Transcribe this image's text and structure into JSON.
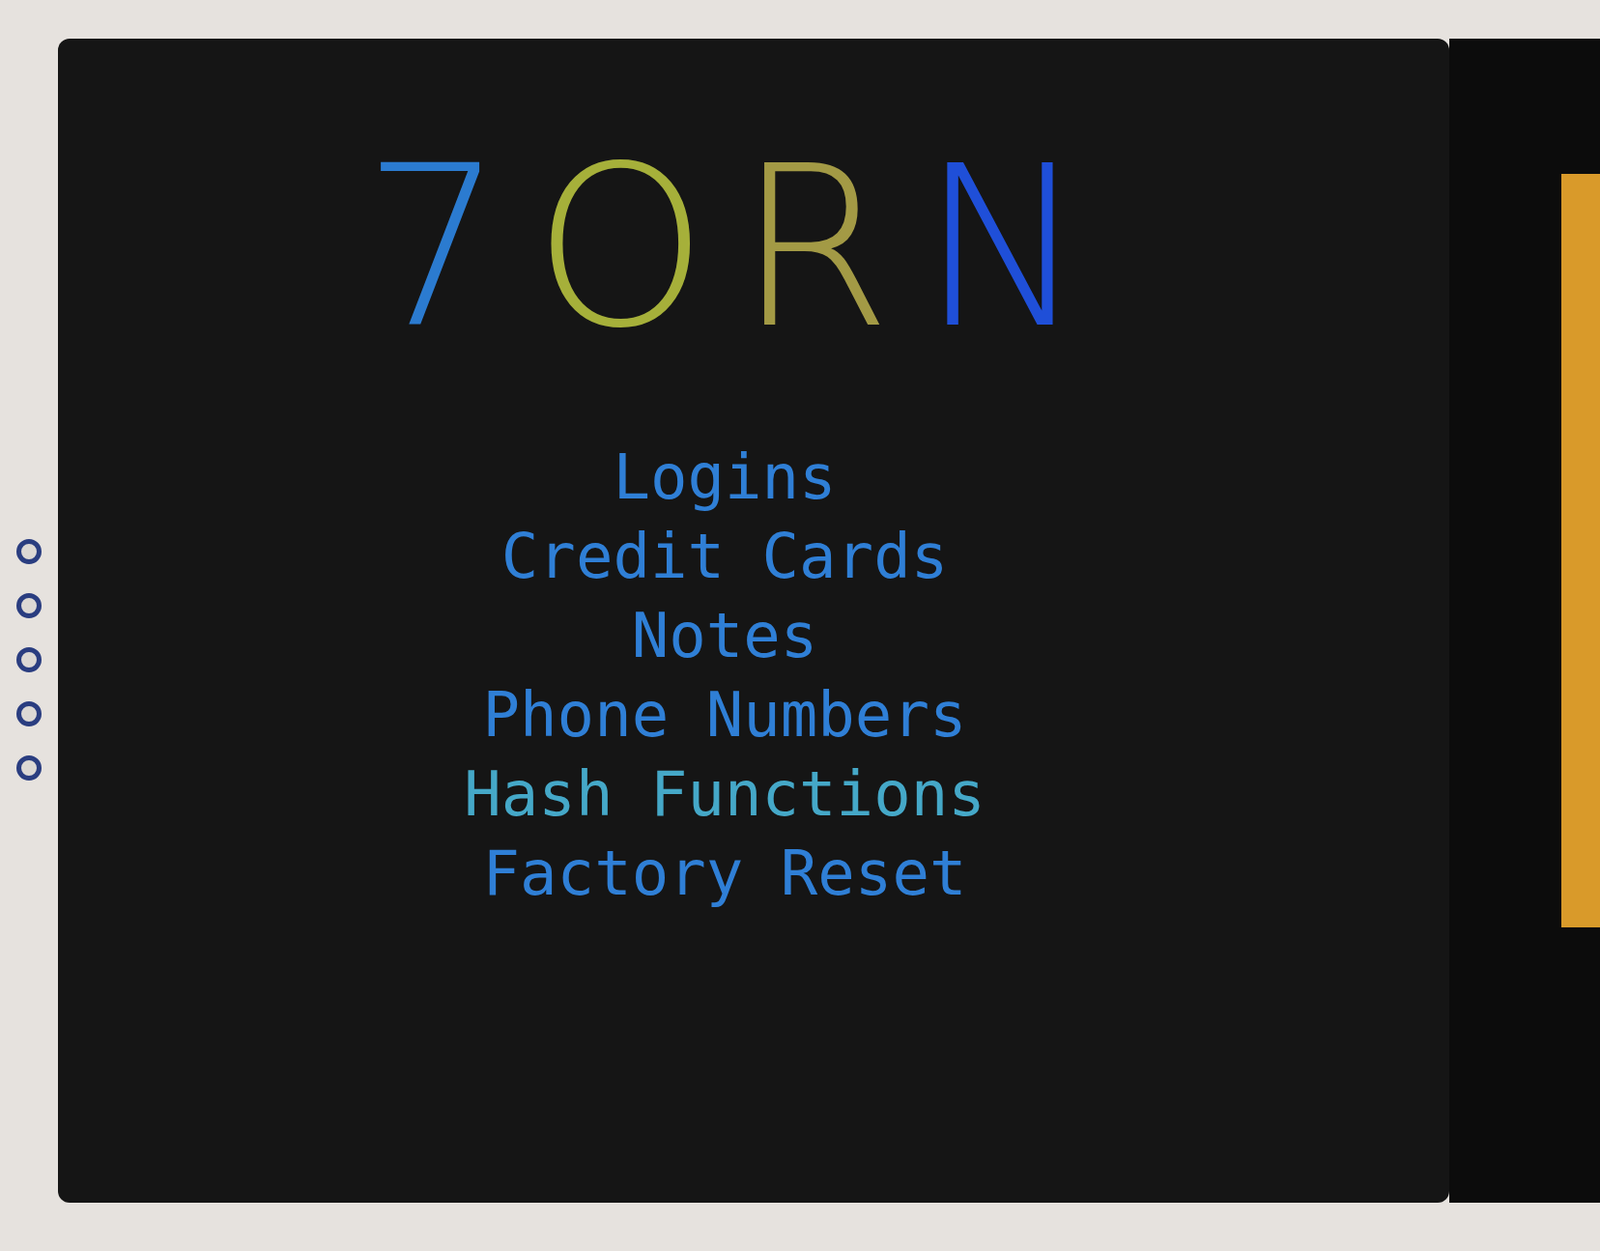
{
  "logo": [
    {
      "char": "7",
      "color": "#2b7bd0"
    },
    {
      "char": "O",
      "color": "#a6b03a"
    },
    {
      "char": "R",
      "color": "#a39a45"
    },
    {
      "char": "N",
      "color": "#1f4fd8"
    }
  ],
  "menu": [
    {
      "label": "Logins",
      "selected": false
    },
    {
      "label": "Credit Cards",
      "selected": false
    },
    {
      "label": "Notes",
      "selected": false
    },
    {
      "label": "Phone Numbers",
      "selected": false
    },
    {
      "label": "Hash Functions",
      "selected": true
    },
    {
      "label": "Factory Reset",
      "selected": false
    }
  ]
}
